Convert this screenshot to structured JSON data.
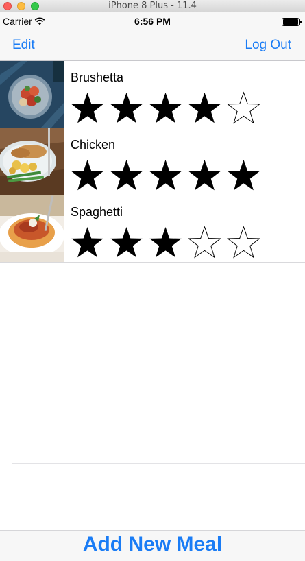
{
  "window": {
    "title": "iPhone 8 Plus - 11.4"
  },
  "status_bar": {
    "carrier": "Carrier",
    "time": "6:56 PM"
  },
  "nav_bar": {
    "edit_label": "Edit",
    "logout_label": "Log Out"
  },
  "meals": [
    {
      "name": "Brushetta",
      "rating": 4,
      "max_rating": 5
    },
    {
      "name": "Chicken",
      "rating": 5,
      "max_rating": 5
    },
    {
      "name": "Spaghetti",
      "rating": 3,
      "max_rating": 5
    }
  ],
  "toolbar": {
    "add_label": "Add New Meal"
  },
  "colors": {
    "tint": "#1a7cf5",
    "bar_background": "#f7f7f7",
    "separator": "#d9d9dc"
  }
}
